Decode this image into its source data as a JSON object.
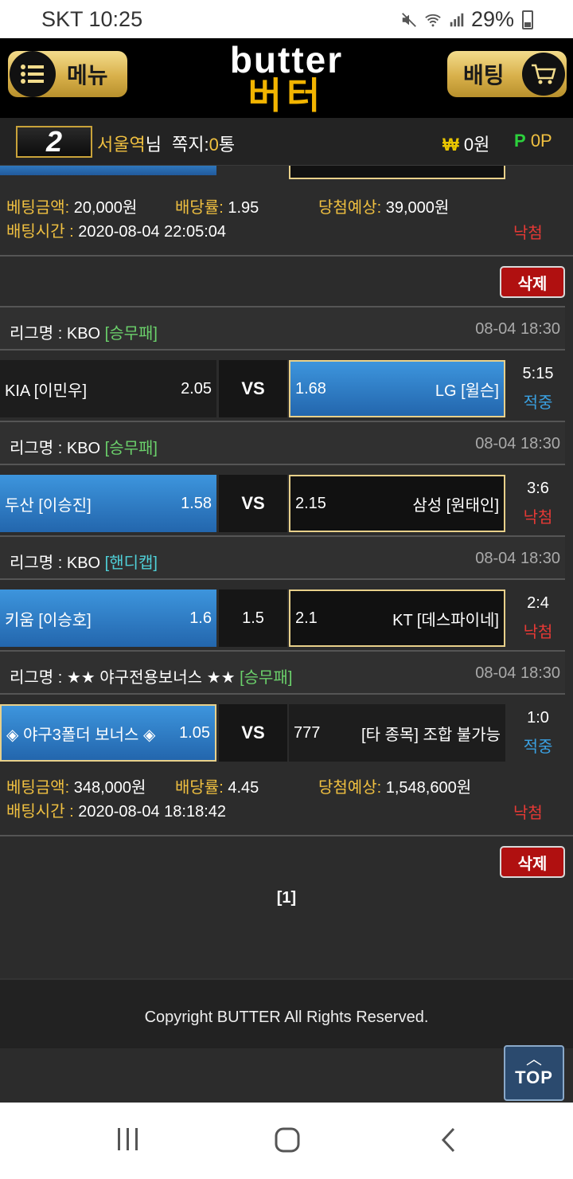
{
  "status_bar": {
    "carrier_time": "SKT 10:25",
    "battery": "29%"
  },
  "header": {
    "menu_label": "메뉴",
    "bet_label": "배팅",
    "logo_en": "butter",
    "logo_ko": "버터"
  },
  "user_bar": {
    "level": "2",
    "nickname": "서울역",
    "suffix": "님",
    "msg_label": "쪽지:",
    "msg_count": "0",
    "msg_unit": "통",
    "money_symbol": "₩",
    "money": "0원",
    "point_symbol": "P",
    "point": "0P"
  },
  "bet1": {
    "amount_label": "베팅금액:",
    "amount": "20,000원",
    "odds_label": "배당률:",
    "odds": "1.95",
    "expected_label": "당첨예상:",
    "expected": "39,000원",
    "time_label": "배팅시간 :",
    "time": "2020-08-04 22:05:04",
    "result": "낙첨",
    "delete_label": "삭제"
  },
  "games": [
    {
      "league_label": "리그명 : KBO",
      "type": "[승무패]",
      "date": "08-04 18:30",
      "home": "KIA [이민우]",
      "home_odds": "2.05",
      "mid": "VS",
      "away_odds": "1.68",
      "away": "LG [윌슨]",
      "score": "5:15",
      "result": "적중"
    },
    {
      "league_label": "리그명 : KBO",
      "type": "[승무패]",
      "date": "08-04 18:30",
      "home": "두산 [이승진]",
      "home_odds": "1.58",
      "mid": "VS",
      "away_odds": "2.15",
      "away": "삼성 [원태인]",
      "score": "3:6",
      "result": "낙첨"
    },
    {
      "league_label": "리그명 : KBO",
      "type": "[핸디캡]",
      "date": "08-04 18:30",
      "home": "키움 [이승호]",
      "home_odds": "1.6",
      "mid": "1.5",
      "away_odds": "2.1",
      "away": "KT [데스파이네]",
      "score": "2:4",
      "result": "낙첨"
    },
    {
      "league_label": "리그명 : ★★ 야구전용보너스 ★★",
      "type": "[승무패]",
      "date": "08-04 18:30",
      "home": "◈ 야구3폴더 보너스 ◈",
      "home_odds": "1.05",
      "mid": "VS",
      "away_odds": "777",
      "away": "[타 종목] 조합 불가능",
      "score": "1:0",
      "result": "적중"
    }
  ],
  "bet2": {
    "amount_label": "베팅금액:",
    "amount": "348,000원",
    "odds_label": "배당률:",
    "odds": "4.45",
    "expected_label": "당첨예상:",
    "expected": "1,548,600원",
    "time_label": "배팅시간 :",
    "time": "2020-08-04 18:18:42",
    "result": "낙첨",
    "delete_label": "삭제"
  },
  "pager": "[1]",
  "footer": "Copyright BUTTER All Rights Reserved.",
  "top_button": "TOP"
}
